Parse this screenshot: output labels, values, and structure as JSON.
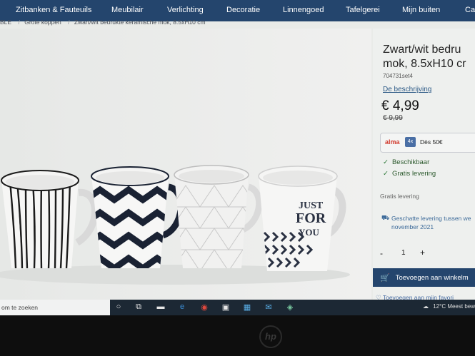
{
  "nav": {
    "items": [
      "Zitbanken & Fauteuils",
      "Meubilair",
      "Verlichting",
      "Decoratie",
      "Linnengoed",
      "Tafelgerei",
      "Mijn buiten",
      "Cad"
    ]
  },
  "breadcrumb": {
    "items": [
      "BLE",
      "Grote koppen",
      "Zwart/wit bedrukte keramische mok, 8.5xH10 cm"
    ],
    "separator": "/"
  },
  "mugs": {
    "mug4_text": [
      "JUST",
      "FOR",
      "YOU"
    ]
  },
  "product": {
    "title_line1": "Zwart/wit bedru",
    "title_line2": "mok, 8.5xH10 cr",
    "sku": "704731set4",
    "description_link": "De beschrijving",
    "price": "€ 4,99",
    "old_price": "€ 9,99",
    "alma": {
      "logo": "alma",
      "badge": "4x",
      "text": "Dès 50€"
    },
    "availability": "Beschikbaar",
    "free_shipping": "Gratis levering",
    "shipping_note": "Gratis levering",
    "delivery": "Geschatte levering tussen we november 2021",
    "qty_minus": "-",
    "qty_value": "1",
    "qty_plus": "+",
    "add_to_cart": "Toevoegen aan winkelm",
    "wishlist": "Toevoegen aan mijn favori"
  },
  "taskbar": {
    "search_placeholder": "om te zoeken",
    "weather": "12°C  Meest bew"
  },
  "bezel": {
    "logo": "hp"
  }
}
